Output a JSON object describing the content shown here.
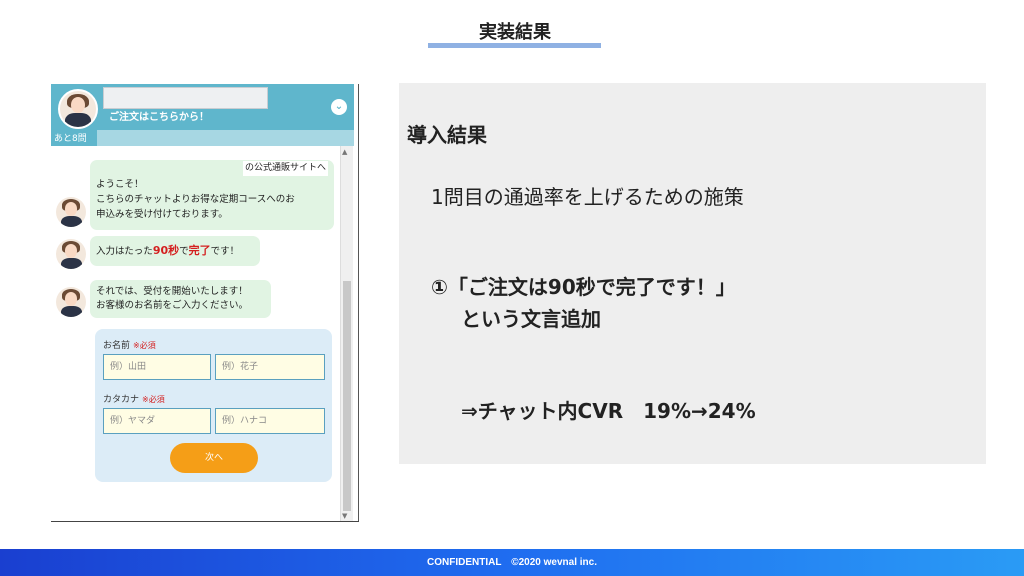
{
  "slide": {
    "title": "実装結果"
  },
  "chat": {
    "header_text": "ご注文はこちらから！",
    "remaining": "あと8問",
    "collapse_icon": "chevron-down-icon",
    "messages": [
      {
        "top": "の公式通販サイトへ",
        "lines": [
          "ようこそ！",
          "こちらのチャットよりお得な定期コースへのお",
          "申込みを受け付けております。"
        ]
      },
      {
        "prefix": "入力はたった",
        "highlight1": "90秒",
        "mid": "で",
        "highlight2": "完了",
        "suffix": "です！"
      },
      {
        "lines": [
          "それでは、受付を開始いたします！",
          "お客様のお名前をご入力ください。"
        ]
      }
    ],
    "form": {
      "name_label": "お名前",
      "name_required": "※必須",
      "last_name_placeholder": "例）山田",
      "first_name_placeholder": "例）花子",
      "kana_label": "カタカナ",
      "kana_required": "※必須",
      "last_kana_placeholder": "例）ヤマダ",
      "first_kana_placeholder": "例）ハナコ",
      "next_label": "次へ"
    }
  },
  "result": {
    "title": "導入結果",
    "subtitle": "1問目の通過率を上げるための施策",
    "line1": "①「ご注文は90秒で完了です！」",
    "line2": "という文言追加",
    "line3": "⇒チャット内CVR　19%→24%"
  },
  "footer": {
    "text": "CONFIDENTIAL　©2020 wevnal inc."
  }
}
